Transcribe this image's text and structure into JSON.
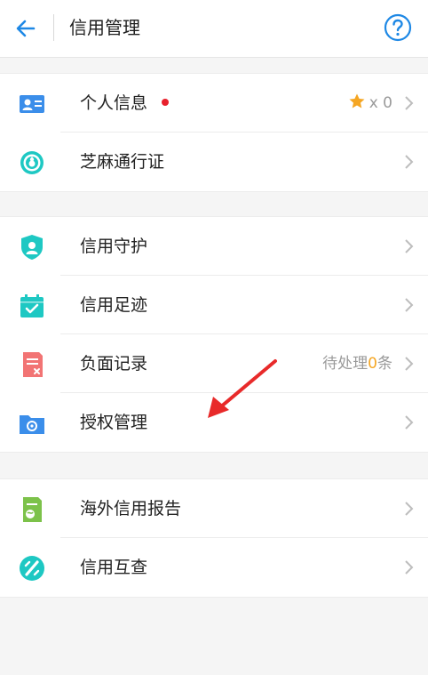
{
  "header": {
    "title": "信用管理"
  },
  "groups": [
    {
      "items": [
        {
          "label": "个人信息",
          "star_count": "x 0"
        },
        {
          "label": "芝麻通行证"
        }
      ]
    },
    {
      "items": [
        {
          "label": "信用守护"
        },
        {
          "label": "信用足迹"
        },
        {
          "label": "负面记录",
          "pending_prefix": "待处理",
          "pending_count": "0",
          "pending_suffix": "条"
        },
        {
          "label": "授权管理"
        }
      ]
    },
    {
      "items": [
        {
          "label": "海外信用报告"
        },
        {
          "label": "信用互查"
        }
      ]
    }
  ],
  "colors": {
    "accent_blue": "#1e88e5",
    "teal": "#1ec8c3",
    "red_dot": "#e8202c",
    "star": "#f5a623",
    "arrow": "#e82a2a"
  },
  "icons": {
    "back": "back-arrow-icon",
    "help": "question-mark-icon",
    "personal_info": "id-card-icon",
    "zhima_pass": "zhima-ring-icon",
    "credit_guard": "shield-user-icon",
    "credit_footprint": "calendar-check-icon",
    "negative_record": "document-x-icon",
    "authorization": "folder-gear-icon",
    "overseas_report": "report-document-icon",
    "credit_mutual_check": "slash-circle-icon",
    "star": "star-icon",
    "chevron": "chevron-right-icon"
  }
}
